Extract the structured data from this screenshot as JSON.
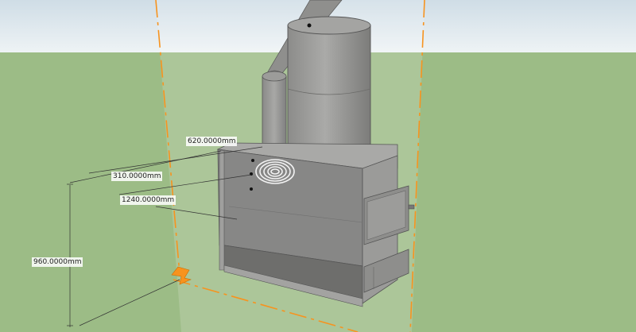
{
  "scene": {
    "sky_color": "#dfe9ee",
    "ground_color": "#9cbc86",
    "section_plane_color": "#f7931e",
    "model_color": "#9a9a98"
  },
  "dimensions": [
    {
      "id": "top-width",
      "label": "620.0000mm"
    },
    {
      "id": "coil-offset",
      "label": "310.0000mm"
    },
    {
      "id": "box-depth",
      "label": "1240.0000mm"
    },
    {
      "id": "box-height",
      "label": "960.0000mm"
    }
  ],
  "objects": [
    "chimney-pipe",
    "water-tank",
    "coil",
    "firebox",
    "fire-door",
    "ash-door",
    "section-plane"
  ]
}
